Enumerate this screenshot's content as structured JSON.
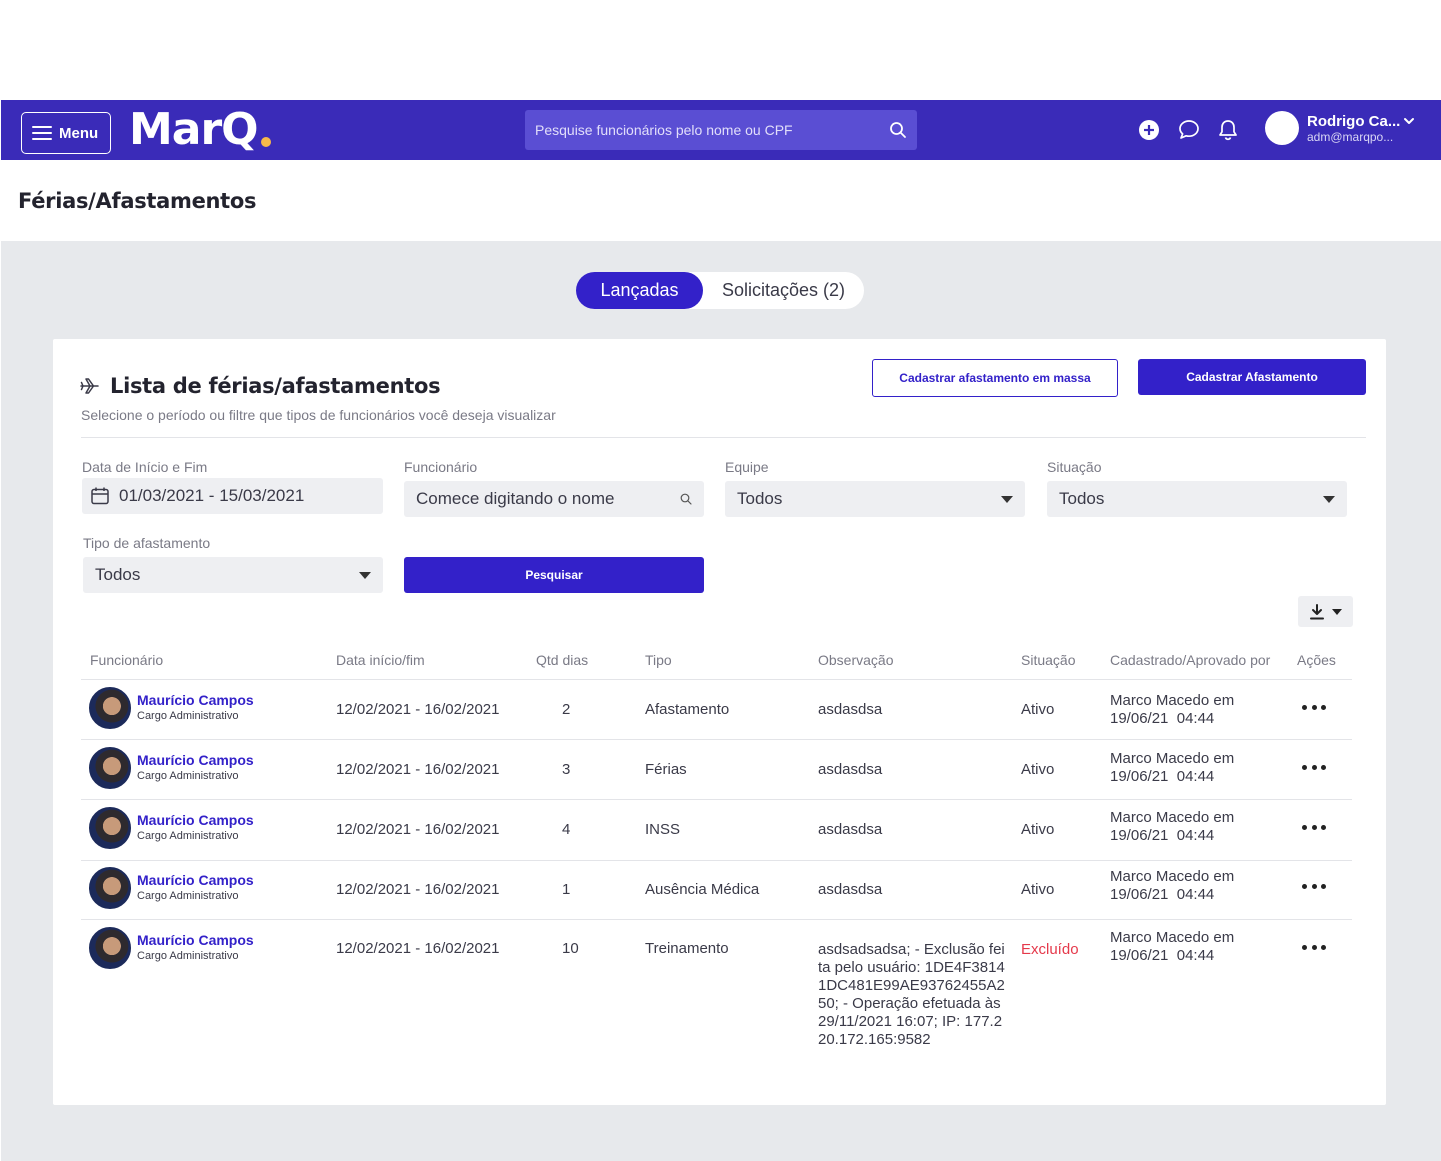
{
  "header": {
    "menu_label": "Menu",
    "logo_text": "MarQ",
    "search_placeholder": "Pesquise funcionários pelo nome ou CPF",
    "user_name": "Rodrigo Ca...",
    "user_email": "adm@marqpo...",
    "colors": {
      "bar": "#3a2bb8",
      "accent": "#3321c9",
      "logo_dot": "#f6b94a"
    }
  },
  "page_title": "Férias/Afastamentos",
  "tabs": [
    {
      "label": "Lançadas",
      "active": true
    },
    {
      "label": "Solicitações (2)",
      "active": false
    }
  ],
  "card": {
    "title": "Lista de férias/afastamentos",
    "subtitle": "Selecione o período ou filtre que tipos de funcionários você deseja visualizar",
    "btn_bulk": "Cadastrar afastamento em massa",
    "btn_new": "Cadastrar Afastamento"
  },
  "filters": {
    "date_label": "Data de Início e Fim",
    "date_value": "01/03/2021 - 15/03/2021",
    "employee_label": "Funcionário",
    "employee_placeholder": "Comece digitando o nome",
    "team_label": "Equipe",
    "team_value": "Todos",
    "status_label": "Situação",
    "status_value": "Todos",
    "type_label": "Tipo de afastamento",
    "type_value": "Todos",
    "search_button": "Pesquisar"
  },
  "table": {
    "columns": [
      "Funcionário",
      "Data início/fim",
      "Qtd dias",
      "Tipo",
      "Observação",
      "Situação",
      "Cadastrado/Aprovado por",
      "Ações"
    ],
    "rows": [
      {
        "name": "Maurício Campos",
        "role": "Cargo Administrativo",
        "dates": "12/02/2021 - 16/02/2021",
        "days": "2",
        "type": "Afastamento",
        "obs": "asdasdsa",
        "status": "Ativo",
        "by1": "Marco Macedo em",
        "by2": "19/06/21  04:44"
      },
      {
        "name": "Maurício Campos",
        "role": "Cargo Administrativo",
        "dates": "12/02/2021 - 16/02/2021",
        "days": "3",
        "type": "Férias",
        "obs": "asdasdsa",
        "status": "Ativo",
        "by1": "Marco Macedo em",
        "by2": "19/06/21  04:44"
      },
      {
        "name": "Maurício Campos",
        "role": "Cargo Administrativo",
        "dates": "12/02/2021 - 16/02/2021",
        "days": "4",
        "type": "INSS",
        "obs": "asdasdsa",
        "status": "Ativo",
        "by1": "Marco Macedo em",
        "by2": "19/06/21  04:44"
      },
      {
        "name": "Maurício Campos",
        "role": "Cargo Administrativo",
        "dates": "12/02/2021 - 16/02/2021",
        "days": "1",
        "type": "Ausência Médica",
        "obs": "asdasdsa",
        "status": "Ativo",
        "by1": "Marco Macedo em",
        "by2": "19/06/21  04:44"
      },
      {
        "name": "Maurício Campos",
        "role": "Cargo Administrativo",
        "dates": "12/02/2021 - 16/02/2021",
        "days": "10",
        "type": "Treinamento",
        "obs": "asdsadsadsa; - Exclusão feita pelo usuário: 1DE4F38141DC481E99AE93762455A250; - Operação efetuada às 29/11/2021 16:07; IP: 177.220.172.165:9582",
        "status": "Excluído",
        "by1": "Marco Macedo em",
        "by2": "19/06/21  04:44"
      }
    ]
  }
}
